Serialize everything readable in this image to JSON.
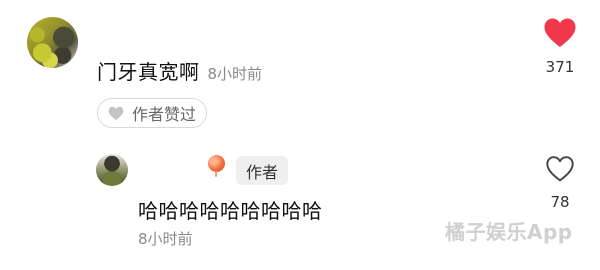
{
  "comment": {
    "text": "门牙真宽啊",
    "time": "8小时前",
    "like_count": "371",
    "liked": true,
    "like_color": "#f2374b",
    "author_liked_label": "作者赞过"
  },
  "reply": {
    "author_badge": "作者",
    "text": "哈哈哈哈哈哈哈哈哈",
    "time": "8小时前",
    "like_count": "78",
    "liked": false
  },
  "watermark": "橘子娱乐App",
  "icons": {
    "main_like": "heart-filled-icon",
    "reply_like": "heart-outline-icon",
    "chip_heart": "heart-filled-small-icon",
    "name_badge": "balloon-icon"
  }
}
